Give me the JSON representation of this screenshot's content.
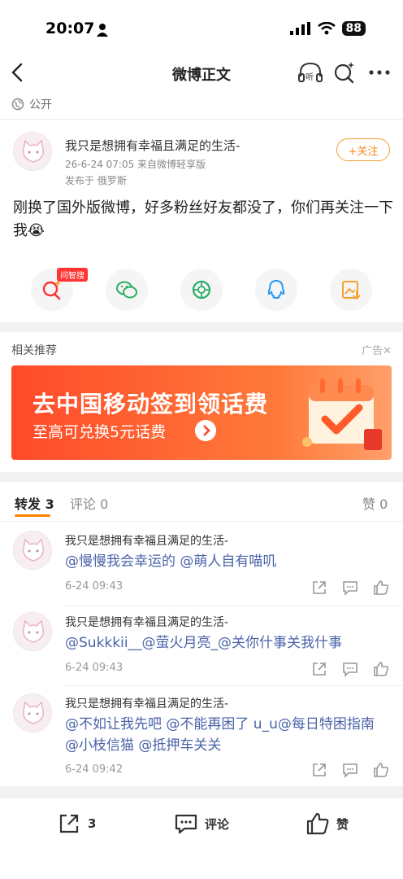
{
  "status_bar": {
    "time": "20:07",
    "battery": "88"
  },
  "nav": {
    "title": "微博正文"
  },
  "visibility": {
    "label": "公开"
  },
  "post": {
    "author": "我只是想拥有幸福且满足的生活-",
    "time_source": "26-6-24 07:05  来自微博轻享版",
    "location": "发布于 俄罗斯",
    "follow_label": "+关注",
    "text": "刚换了国外版微博，好多粉丝好友都没了，你们再关注一下我😭"
  },
  "share": {
    "badge": "问智搜"
  },
  "recommend": {
    "title": "相关推荐",
    "ad_label": "广告✕"
  },
  "banner": {
    "title": "去中国移动签到领话费",
    "subtitle": "至高可兑换5元话费"
  },
  "tabs": {
    "repost_label": "转发",
    "repost_count": "3",
    "comment_label": "评论 0",
    "like_label": "赞 0"
  },
  "reposts": [
    {
      "author": "我只是想拥有幸福且满足的生活-",
      "text": "@慢慢我会幸运的 @萌人自有喵叽",
      "time": "6-24 09:43"
    },
    {
      "author": "我只是想拥有幸福且满足的生活-",
      "text": "@Sukkkii__@萤火月亮_@关你什事关我什事",
      "time": "6-24 09:43"
    },
    {
      "author": "我只是想拥有幸福且满足的生活-",
      "text": "@不如让我先吧 @不能再困了 u_u@每日特困指南 @小枝信猫 @抵押车关关",
      "time": "6-24 09:42"
    }
  ],
  "bottom_bar": {
    "repost_count": "3",
    "comment_label": "评论",
    "like_label": "赞"
  },
  "colors": {
    "accent": "#ff8200",
    "link": "#4a63a8",
    "banner": "#ff4a2a"
  }
}
